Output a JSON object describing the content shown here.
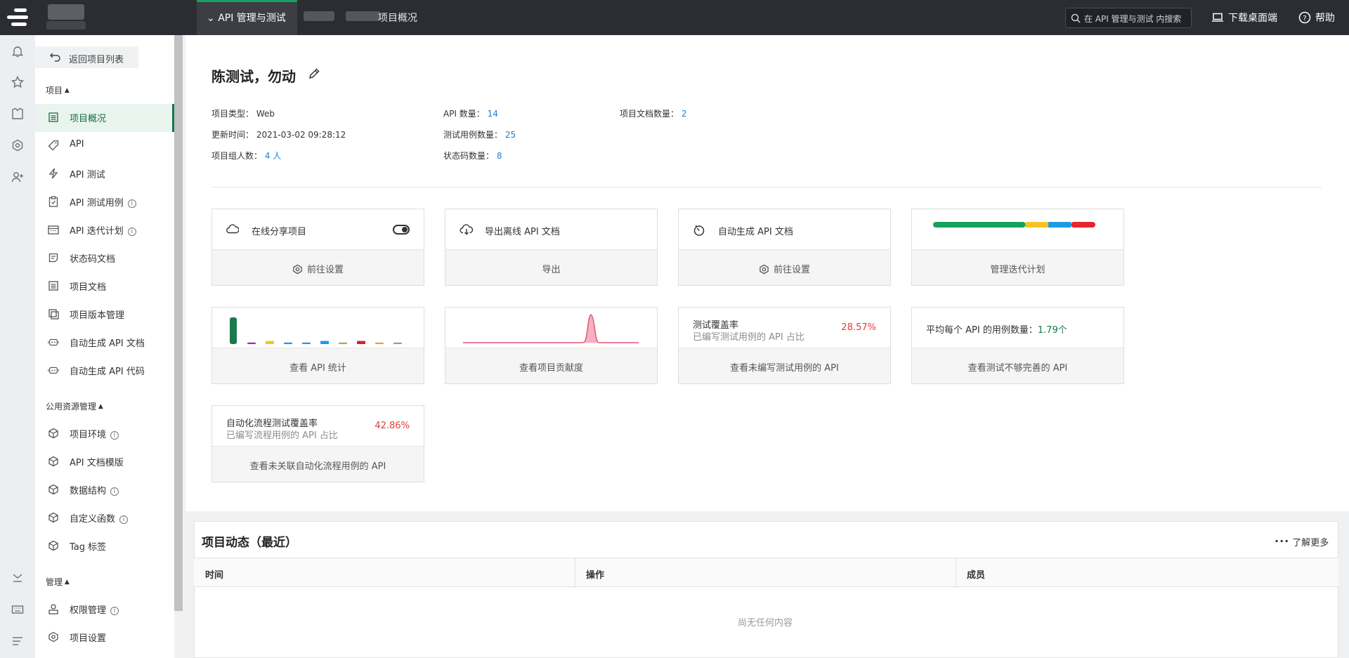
{
  "header": {
    "module_tab": "API 管理与测试",
    "breadcrumb_page": "项目概况",
    "search_placeholder": "在 API 管理与测试 内搜索",
    "download_label": "下载桌面端",
    "help_label": "帮助"
  },
  "sidebar": {
    "back_label": "返回项目列表",
    "sections": [
      {
        "title": "项目",
        "items": [
          "项目概况",
          "API",
          "API 测试",
          "API 测试用例",
          "API 迭代计划",
          "状态码文档",
          "项目文档",
          "项目版本管理",
          "自动生成 API 文档",
          "自动生成 API 代码"
        ]
      },
      {
        "title": "公用资源管理",
        "items": [
          "项目环境",
          "API 文档模版",
          "数据结构",
          "自定义函数",
          "Tag 标签"
        ]
      },
      {
        "title": "管理",
        "items": [
          "权限管理",
          "项目设置"
        ]
      }
    ]
  },
  "project": {
    "title": "陈测试，勿动",
    "type_label": "项目类型：",
    "type_value": "Web",
    "updated_label": "更新时间：",
    "updated_value": "2021-03-02 09:28:12",
    "members_label": "项目组人数：",
    "members_value": "4 人",
    "api_count_label": "API 数量：",
    "api_count_value": "14",
    "case_count_label": "测试用例数量：",
    "case_count_value": "25",
    "status_count_label": "状态码数量：",
    "status_count_value": "8",
    "doc_count_label": "项目文档数量：",
    "doc_count_value": "2"
  },
  "cards": {
    "share": {
      "title": "在线分享项目",
      "action": "前往设置"
    },
    "export": {
      "title": "导出离线 API 文档",
      "action": "导出"
    },
    "autogen": {
      "title": "自动生成 API 文档",
      "action": "前往设置"
    },
    "iteration": {
      "action": "管理迭代计划",
      "bar_colors": [
        "#13a35c",
        "#f6c325",
        "#1c9be6",
        "#e8242c"
      ],
      "bar_shares": [
        0.57,
        0.14,
        0.14,
        0.15
      ]
    },
    "api_stats": {
      "action": "查看 API 统计",
      "bars": [
        {
          "value": 1.0,
          "color": "#1a7a4b"
        },
        {
          "value": 0.06,
          "color": "#8e3c9a"
        },
        {
          "value": 0.12,
          "color": "#f6c325"
        },
        {
          "value": 0.06,
          "color": "#1c9be6"
        },
        {
          "value": 0.06,
          "color": "#1c9be6"
        },
        {
          "value": 0.12,
          "color": "#1c9be6"
        },
        {
          "value": 0.06,
          "color": "#8dbb3c"
        },
        {
          "value": 0.12,
          "color": "#d81e2c"
        },
        {
          "value": 0.06,
          "color": "#f0a030"
        },
        {
          "value": 0.06,
          "color": "#999999"
        }
      ]
    },
    "contribution": {
      "action": "查看项目贡献度",
      "line_color": "#e0567a"
    },
    "coverage": {
      "title": "测试覆盖率",
      "subtitle": "已编写测试用例的 API 占比",
      "percent": "28.57%",
      "action": "查看未编写测试用例的 API"
    },
    "avg_cases": {
      "label": "平均每个 API 的用例数量：",
      "value": "1.79个",
      "action": "查看测试不够完善的 API"
    },
    "flow_coverage": {
      "title": "自动化流程测试覆盖率",
      "subtitle": "已编写流程用例的 API 占比",
      "percent": "42.86%",
      "action": "查看未关联自动化流程用例的 API"
    }
  },
  "activity": {
    "title": "项目动态（最近）",
    "more": "了解更多",
    "columns": [
      "时间",
      "操作",
      "成员"
    ],
    "empty": "尚无任何内容"
  }
}
